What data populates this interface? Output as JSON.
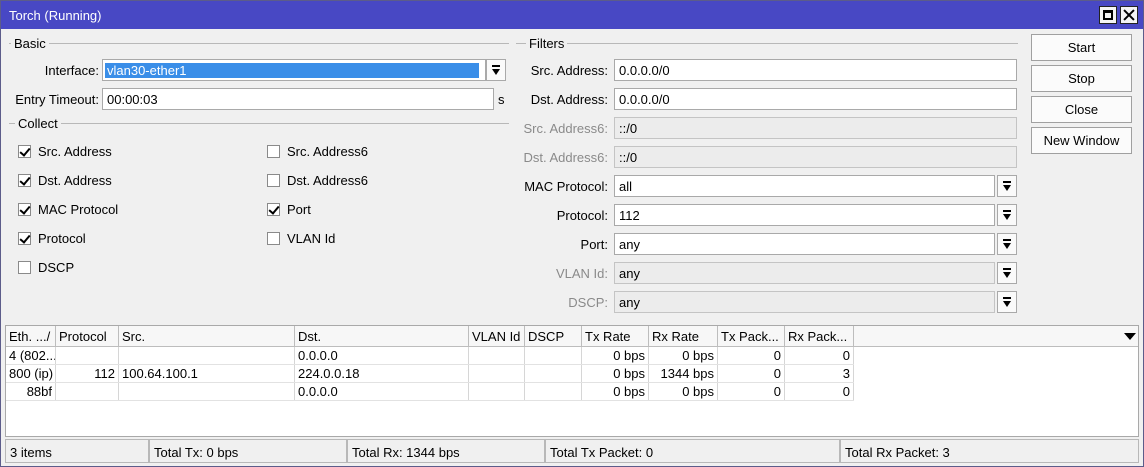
{
  "window": {
    "title": "Torch (Running)"
  },
  "basic": {
    "group_label": "Basic",
    "interface_label": "Interface:",
    "interface_value": "vlan30-ether1",
    "entry_timeout_label": "Entry Timeout:",
    "entry_timeout_value": "00:00:03",
    "entry_timeout_unit": "s"
  },
  "collect": {
    "group_label": "Collect",
    "items": [
      {
        "label": "Src. Address",
        "checked": true
      },
      {
        "label": "Dst. Address",
        "checked": true
      },
      {
        "label": "MAC Protocol",
        "checked": true
      },
      {
        "label": "Protocol",
        "checked": true
      },
      {
        "label": "DSCP",
        "checked": false
      },
      {
        "label": "Src. Address6",
        "checked": false
      },
      {
        "label": "Dst. Address6",
        "checked": false
      },
      {
        "label": "Port",
        "checked": true
      },
      {
        "label": "VLAN Id",
        "checked": false
      }
    ]
  },
  "filters": {
    "group_label": "Filters",
    "src_address_label": "Src. Address:",
    "src_address_value": "0.0.0.0/0",
    "dst_address_label": "Dst. Address:",
    "dst_address_value": "0.0.0.0/0",
    "src_address6_label": "Src. Address6:",
    "src_address6_value": "::/0",
    "dst_address6_label": "Dst. Address6:",
    "dst_address6_value": "::/0",
    "mac_protocol_label": "MAC Protocol:",
    "mac_protocol_value": "all",
    "protocol_label": "Protocol:",
    "protocol_value": "112",
    "port_label": "Port:",
    "port_value": "any",
    "vlan_id_label": "VLAN Id:",
    "vlan_id_value": "any",
    "dscp_label": "DSCP:",
    "dscp_value": "any"
  },
  "buttons": {
    "start": "Start",
    "stop": "Stop",
    "close": "Close",
    "new_window": "New Window"
  },
  "table": {
    "columns": [
      "Eth. ...",
      "/",
      "Protocol",
      "Src.",
      "Dst.",
      "VLAN Id",
      "DSCP",
      "Tx Rate",
      "Rx Rate",
      "Tx Pack...",
      "Rx Pack..."
    ],
    "rows": [
      {
        "eth": "4 (802...",
        "protocol": "",
        "src": "",
        "dst": "0.0.0.0",
        "vlan": "",
        "dscp": "",
        "tx_rate": "0 bps",
        "rx_rate": "0 bps",
        "tx_pack": "0",
        "rx_pack": "0"
      },
      {
        "eth": "800 (ip)",
        "protocol": "112",
        "src": "100.64.100.1",
        "dst": "224.0.0.18",
        "vlan": "",
        "dscp": "",
        "tx_rate": "0 bps",
        "rx_rate": "1344 bps",
        "tx_pack": "0",
        "rx_pack": "3"
      },
      {
        "eth": "88bf",
        "protocol": "",
        "src": "",
        "dst": "0.0.0.0",
        "vlan": "",
        "dscp": "",
        "tx_rate": "0 bps",
        "rx_rate": "0 bps",
        "tx_pack": "0",
        "rx_pack": "0"
      }
    ]
  },
  "status_bar": {
    "items": "3 items",
    "total_tx": "Total Tx: 0 bps",
    "total_rx": "Total Rx: 1344 bps",
    "total_tx_packet": "Total Tx Packet: 0",
    "total_rx_packet": "Total Rx Packet: 3"
  }
}
